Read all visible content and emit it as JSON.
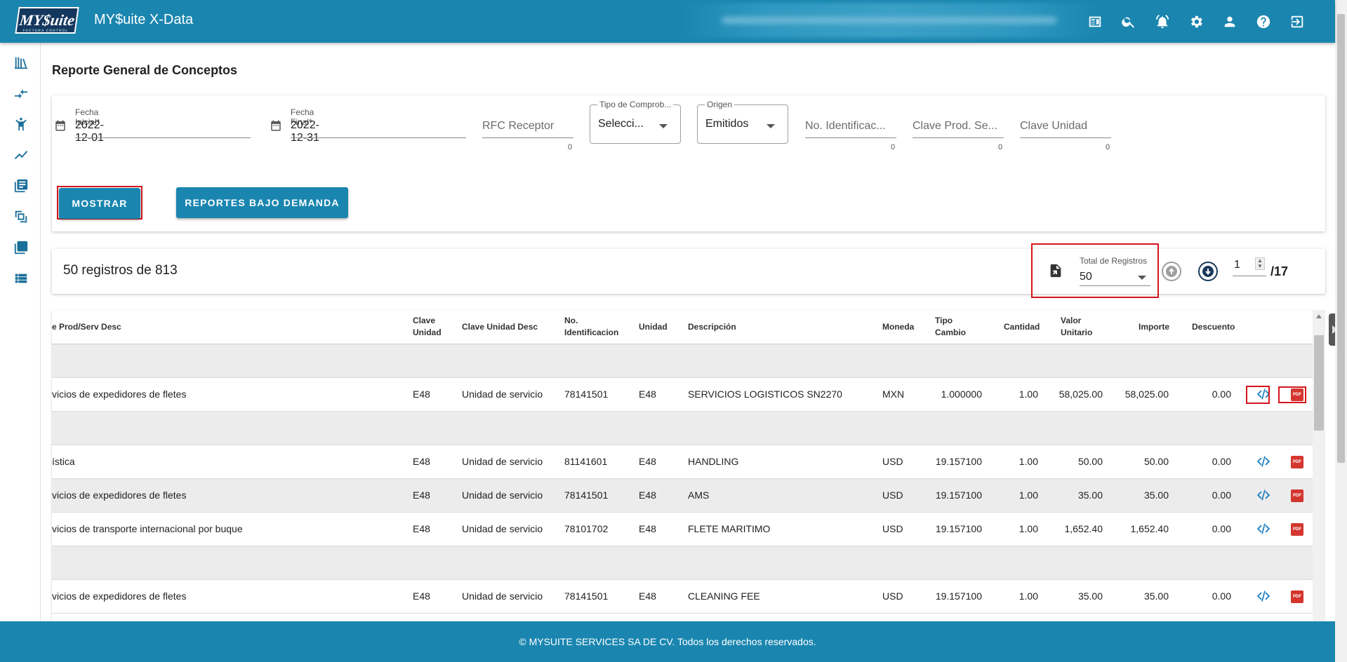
{
  "header": {
    "logo_text": "MY$uite",
    "logo_sub": "FACTURA CONTROL",
    "app_title": "MY$uite X-Data",
    "icons": [
      "id-card-icon",
      "search-icon",
      "bell-icon",
      "gear-icon",
      "user-icon",
      "help-icon",
      "logout-icon"
    ]
  },
  "sidebar": {
    "icons": [
      "library-icon",
      "compare-arrows-icon",
      "person-icon",
      "trend-chart-icon",
      "document-list-icon",
      "file-convert-icon",
      "layers-icon",
      "list-view-icon"
    ]
  },
  "page": {
    "title": "Reporte General de Conceptos"
  },
  "filters": {
    "fecha_inicial": {
      "label": "Fecha Inicial*",
      "value": "2022-12-01"
    },
    "fecha_final": {
      "label": "Fecha Final*",
      "value": "2022-12-31"
    },
    "rfc_receptor": {
      "placeholder": "RFC Receptor",
      "count": "0"
    },
    "tipo_comprobante": {
      "label": "Tipo de Comprob...",
      "value": "Selecci..."
    },
    "origen": {
      "label": "Origen",
      "value": "Emitidos"
    },
    "no_identificacion": {
      "placeholder": "No. Identificac...",
      "count": "0"
    },
    "clave_prod": {
      "placeholder": "Clave Prod. Se...",
      "count": "0"
    },
    "clave_unidad": {
      "placeholder": "Clave Unidad",
      "count": "0"
    },
    "mostrar_label": "MOSTRAR",
    "reportes_label": "REPORTES BAJO DEMANDA"
  },
  "summary": {
    "text": "50 registros de 813",
    "total_label": "Total de Registros",
    "total_value": "50",
    "page_value": "1",
    "page_total": "/17"
  },
  "table": {
    "headers": {
      "desc": "e Prod/Serv Desc",
      "clave_unidad": "Clave\nUnidad",
      "clave_unidad_desc": "Clave Unidad Desc",
      "no_ident": "No.\nIdentificacion",
      "unidad": "Unidad",
      "descripcion": "Descripción",
      "moneda": "Moneda",
      "tipo_cambio": "Tipo\nCambio",
      "cantidad": "Cantidad",
      "valor_unitario": "Valor\nUnitario",
      "importe": "Importe",
      "descuento": "Descuento"
    },
    "rows": [
      {
        "empty": true
      },
      {
        "desc": "vicios de expedidores de fletes",
        "clave_unidad": "E48",
        "clave_unidad_desc": "Unidad de servicio",
        "no_ident": "78141501",
        "unidad": "E48",
        "descripcion": "SERVICIOS LOGISTICOS SN2270",
        "moneda": "MXN",
        "tipo_cambio": "1.000000",
        "cantidad": "1.00",
        "valor_unitario": "58,025.00",
        "importe": "58,025.00",
        "descuento": "0.00"
      },
      {
        "empty": true
      },
      {
        "desc": "ística",
        "clave_unidad": "E48",
        "clave_unidad_desc": "Unidad de servicio",
        "no_ident": "81141601",
        "unidad": "E48",
        "descripcion": "HANDLING",
        "moneda": "USD",
        "tipo_cambio": "19.157100",
        "cantidad": "1.00",
        "valor_unitario": "50.00",
        "importe": "50.00",
        "descuento": "0.00"
      },
      {
        "desc": "vicios de expedidores de fletes",
        "clave_unidad": "E48",
        "clave_unidad_desc": "Unidad de servicio",
        "no_ident": "78141501",
        "unidad": "E48",
        "descripcion": "AMS",
        "moneda": "USD",
        "tipo_cambio": "19.157100",
        "cantidad": "1.00",
        "valor_unitario": "35.00",
        "importe": "35.00",
        "descuento": "0.00"
      },
      {
        "desc": "vicios de transporte internacional por buque",
        "clave_unidad": "E48",
        "clave_unidad_desc": "Unidad de servicio",
        "no_ident": "78101702",
        "unidad": "E48",
        "descripcion": "FLETE MARITIMO",
        "moneda": "USD",
        "tipo_cambio": "19.157100",
        "cantidad": "1.00",
        "valor_unitario": "1,652.40",
        "importe": "1,652.40",
        "descuento": "0.00"
      },
      {
        "empty": true
      },
      {
        "desc": "vicios de expedidores de fletes",
        "clave_unidad": "E48",
        "clave_unidad_desc": "Unidad de servicio",
        "no_ident": "78141501",
        "unidad": "E48",
        "descripcion": "CLEANING FEE",
        "moneda": "USD",
        "tipo_cambio": "19.157100",
        "cantidad": "1.00",
        "valor_unitario": "35.00",
        "importe": "35.00",
        "descuento": "0.00"
      }
    ],
    "pdf_label": "PDF"
  },
  "footer": {
    "text": "© MYSUITE SERVICES SA DE CV. Todos los derechos reservados."
  },
  "colors": {
    "primary": "#1a86b0",
    "highlight": "#d3161c",
    "pdf": "#d3362f",
    "xml": "#1a7fc4"
  }
}
